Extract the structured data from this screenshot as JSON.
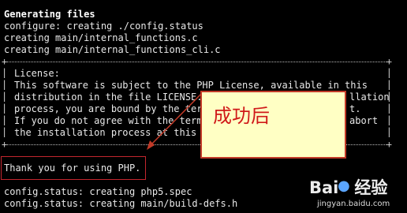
{
  "terminal": {
    "lines": [
      "Generating files",
      "configure: creating ./config.status",
      "creating main/internal_functions.c",
      "creating main/internal_functions_cli.c"
    ],
    "license": [
      "License:",
      "This software is subject to the PHP License, available in this",
      "distribution in the file LICENSE.",
      "process, you are bound by the term",
      "If you do not agree with the terms",
      "the installation process at this p"
    ],
    "license_right": [
      "llation",
      "t.",
      "abort"
    ],
    "thanks": "Thank you for using PHP.",
    "after": [
      "config.status: creating php5.spec",
      "config.status: creating main/build-defs.h"
    ]
  },
  "annotation": {
    "callout_text": "成功后",
    "colors": {
      "callout_bg": "#ffffc4",
      "callout_border": "#c23a28",
      "callout_text": "#d01919",
      "frame": "#c4262e"
    }
  },
  "watermark": {
    "logo": "Bai",
    "logo_suffix": "经验",
    "url": "jingyan.baidu.com",
    "icon": "paw-icon"
  }
}
